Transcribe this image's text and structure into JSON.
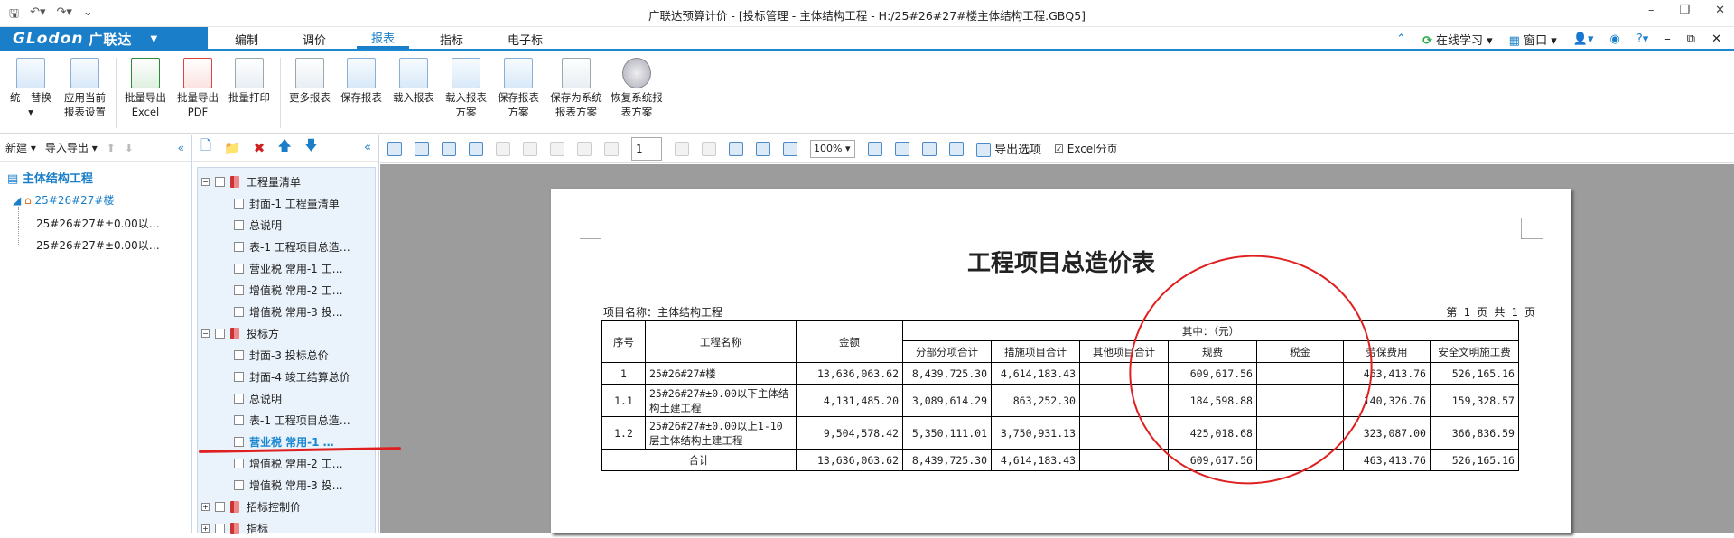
{
  "window": {
    "title": "广联达预算计价 - [投标管理 - 主体结构工程 - H:/25#26#27#楼主体结构工程.GBQ5]"
  },
  "menu": {
    "logo": "GLodon",
    "logo_cn": "广联达",
    "tabs": [
      "编制",
      "调价",
      "报表",
      "指标",
      "电子标"
    ],
    "online": "在线学习",
    "window": "窗口"
  },
  "ribbon": {
    "buttons": [
      "统一替换",
      "应用当前报表设置",
      "批量导出Excel",
      "批量导出PDF",
      "批量打印",
      "更多报表",
      "保存报表",
      "载入报表",
      "载入报表方案",
      "保存报表方案",
      "保存为系统报表方案",
      "恢复系统报表方案"
    ]
  },
  "left": {
    "toolbar": {
      "new": "新建",
      "import_export": "导入导出"
    },
    "tree": {
      "root": "主体结构工程",
      "building": "25#26#27#楼",
      "child1": "25#26#27#±0.00以…",
      "child2": "25#26#27#±0.00以…"
    }
  },
  "reports": {
    "items": [
      {
        "label": "工程量清单",
        "level": 0,
        "type": "group",
        "exp": "⊟"
      },
      {
        "label": "封面-1 工程量清单",
        "level": 1
      },
      {
        "label": "总说明",
        "level": 1
      },
      {
        "label": "表-1 工程项目总造…",
        "level": 1
      },
      {
        "label": "营业税 常用-1 工…",
        "level": 1
      },
      {
        "label": "增值税 常用-2 工…",
        "level": 1
      },
      {
        "label": "增值税 常用-3 投…",
        "level": 1
      },
      {
        "label": "投标方",
        "level": 0,
        "type": "group",
        "exp": "⊟"
      },
      {
        "label": "封面-3 投标总价",
        "level": 1
      },
      {
        "label": "封面-4 竣工结算总价",
        "level": 1
      },
      {
        "label": "总说明",
        "level": 1
      },
      {
        "label": "表-1 工程项目总造…",
        "level": 1
      },
      {
        "label": "营业税 常用-1 …",
        "level": 1,
        "selected": true
      },
      {
        "label": "增值税 常用-2 工…",
        "level": 1
      },
      {
        "label": "增值税 常用-3 投…",
        "level": 1
      },
      {
        "label": "招标控制价",
        "level": 0,
        "type": "group",
        "exp": "⊞"
      },
      {
        "label": "指标",
        "level": 0,
        "type": "group",
        "exp": "⊞"
      }
    ]
  },
  "viewer": {
    "page": "1",
    "zoom": "100%",
    "export_option": "导出选项",
    "excel_page": "Excel分页"
  },
  "report": {
    "title": "工程项目总造价表",
    "project": "项目名称：主体结构工程",
    "pageinfo": "第 1 页  共 1 页",
    "headers": {
      "no": "序号",
      "name": "工程名称",
      "amount": "金额",
      "of_which": "其中：（元）",
      "sub": [
        "分部分项合计",
        "措施项目合计",
        "其他项目合计",
        "规费",
        "税金",
        "劳保费用",
        "安全文明施工费"
      ]
    },
    "rows": [
      {
        "no": "1",
        "name": "25#26#27#楼",
        "amount": "13,636,063.62",
        "v": [
          "8,439,725.30",
          "4,614,183.43",
          "",
          "609,617.56",
          "",
          "463,413.76",
          "526,165.16"
        ]
      },
      {
        "no": "1.1",
        "name": "25#26#27#±0.00以下主体结构土建工程",
        "amount": "4,131,485.20",
        "v": [
          "3,089,614.29",
          "863,252.30",
          "",
          "184,598.88",
          "",
          "140,326.76",
          "159,328.57"
        ]
      },
      {
        "no": "1.2",
        "name": "25#26#27#±0.00以上1-10层主体结构土建工程",
        "amount": "9,504,578.42",
        "v": [
          "5,350,111.01",
          "3,750,931.13",
          "",
          "425,018.68",
          "",
          "323,087.00",
          "366,836.59"
        ]
      }
    ],
    "total": {
      "label": "合计",
      "amount": "13,636,063.62",
      "v": [
        "8,439,725.30",
        "4,614,183.43",
        "",
        "609,617.56",
        "",
        "463,413.76",
        "526,165.16"
      ]
    }
  }
}
